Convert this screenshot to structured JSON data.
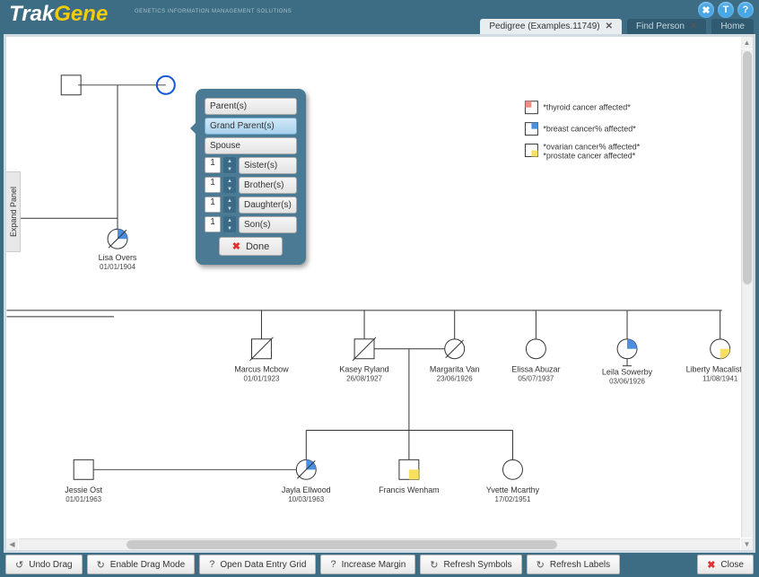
{
  "app": {
    "logo_a": "Trak",
    "logo_b": "Gene",
    "logo_sub": "GENETICS\nINFORMATION\nMANAGEMENT\nSOLUTIONS"
  },
  "header_icons": [
    "✖",
    "T",
    "?"
  ],
  "tabs": {
    "active": {
      "label": "Pedigree (Examples.11749)"
    },
    "find": {
      "label": "Find Person"
    },
    "home": {
      "label": "Home"
    }
  },
  "expand_panel": "Expand Panel",
  "popup": {
    "items": [
      {
        "label": "Parent(s)",
        "count": null
      },
      {
        "label": "Grand Parent(s)",
        "count": null,
        "selected": true
      },
      {
        "label": "Spouse",
        "count": null
      },
      {
        "label": "Sister(s)",
        "count": "1"
      },
      {
        "label": "Brother(s)",
        "count": "1"
      },
      {
        "label": "Daughter(s)",
        "count": "1"
      },
      {
        "label": "Son(s)",
        "count": "1"
      }
    ],
    "done": "Done"
  },
  "legend": [
    {
      "label": "*thyroid cancer affected*",
      "fill": "#f28b82",
      "quad": "tl"
    },
    {
      "label": "*breast cancer% affected*",
      "fill": "#4a90e2",
      "quad": "tr"
    },
    {
      "label": "*ovarian cancer% affected*",
      "fill": "none",
      "quad": "none"
    },
    {
      "label": "*prostate cancer affected*",
      "fill": "#f6e05e",
      "quad": "br"
    }
  ],
  "people": {
    "lisa": {
      "name": "Lisa Overs",
      "date": "01/01/1904"
    },
    "marcus": {
      "name": "Marcus Mcbow",
      "date": "01/01/1923"
    },
    "kasey": {
      "name": "Kasey Ryland",
      "date": "26/08/1927"
    },
    "margarita": {
      "name": "Margarita Van",
      "date": "23/06/1926"
    },
    "elissa": {
      "name": "Elissa Abuzar",
      "date": "05/07/1937"
    },
    "leila": {
      "name": "Leila Sowerby",
      "date": "03/06/1926"
    },
    "liberty": {
      "name": "Liberty Macalister",
      "date": "11/08/1941"
    },
    "jessie": {
      "name": "Jessie Ost",
      "date": "01/01/1963"
    },
    "jayla": {
      "name": "Jayla Ellwood",
      "date": "10/03/1963"
    },
    "francis": {
      "name": "Francis Wenham",
      "date": ""
    },
    "yvette": {
      "name": "Yvette Mcarthy",
      "date": "17/02/1951"
    }
  },
  "footer": {
    "undo": "Undo Drag",
    "drag": "Enable Drag Mode",
    "grid": "Open Data Entry Grid",
    "margin": "Increase Margin",
    "symbols": "Refresh Symbols",
    "labels": "Refresh Labels",
    "close": "Close"
  }
}
